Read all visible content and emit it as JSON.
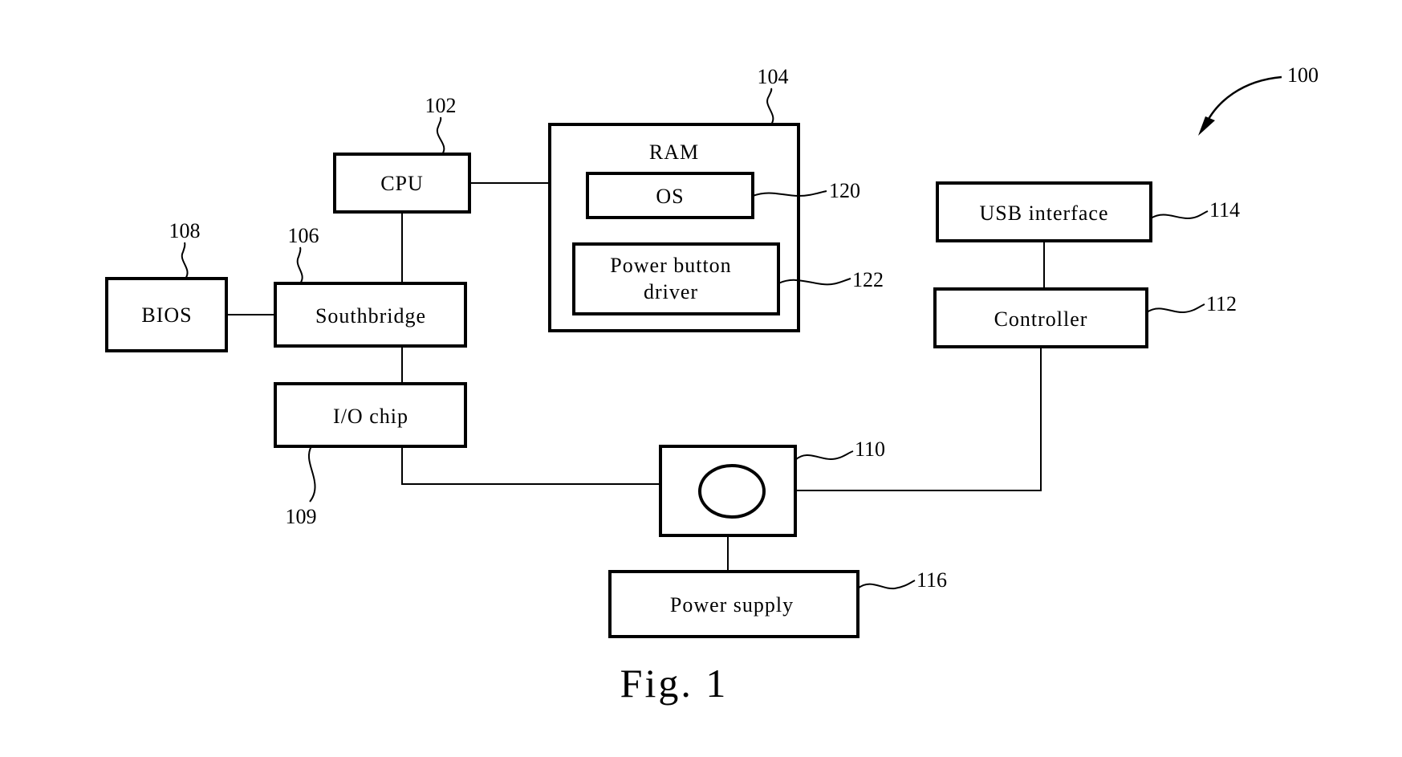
{
  "figure": {
    "caption": "Fig. 1",
    "system_ref": "100"
  },
  "blocks": {
    "cpu": {
      "label": "CPU",
      "ref": "102"
    },
    "ram": {
      "label": "RAM",
      "ref": "104"
    },
    "os": {
      "label": "OS",
      "ref": "120"
    },
    "power_button_driver": {
      "label_line1": "Power button",
      "label_line2": "driver",
      "ref": "122"
    },
    "bios": {
      "label": "BIOS",
      "ref": "108"
    },
    "southbridge": {
      "label": "Southbridge",
      "ref": "106"
    },
    "io_chip": {
      "label": "I/O chip",
      "ref": "109"
    },
    "power_button": {
      "label": "",
      "ref": "110"
    },
    "power_supply": {
      "label": "Power supply",
      "ref": "116"
    },
    "usb_interface": {
      "label": "USB interface",
      "ref": "114"
    },
    "controller": {
      "label": "Controller",
      "ref": "112"
    }
  },
  "connections": [
    [
      "cpu",
      "ram"
    ],
    [
      "cpu",
      "southbridge"
    ],
    [
      "bios",
      "southbridge"
    ],
    [
      "southbridge",
      "io_chip"
    ],
    [
      "io_chip",
      "power_button"
    ],
    [
      "power_button",
      "controller"
    ],
    [
      "power_button",
      "power_supply"
    ],
    [
      "usb_interface",
      "controller"
    ]
  ]
}
